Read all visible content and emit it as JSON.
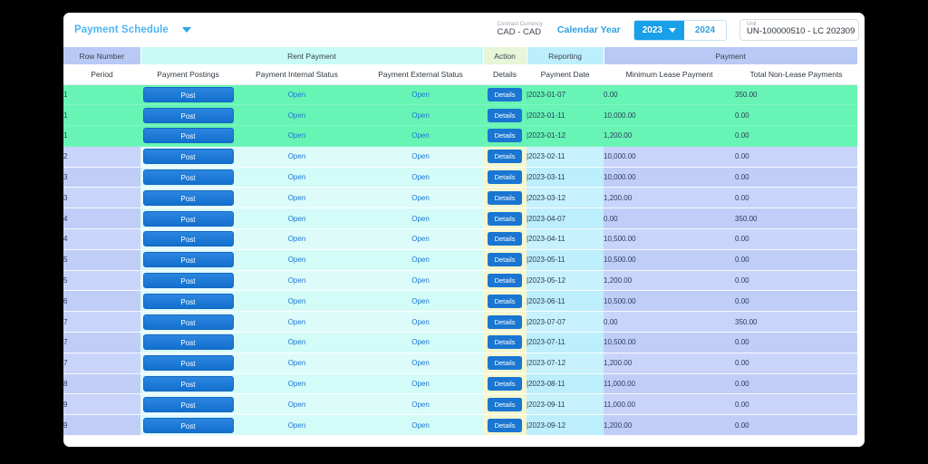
{
  "window": {
    "background": "#000000",
    "card_background": "#ffffff"
  },
  "toolbar": {
    "title": "Payment Schedule",
    "dropdown_icon": "chevron-down-icon",
    "contract_currency_label": "Contract Currency",
    "contract_currency_value": "CAD - CAD",
    "calendar_year_label": "Calendar Year",
    "year_selected": "2023",
    "year_other": "2024",
    "year_caret_icon": "chevron-down-icon",
    "unit_label": "Unit",
    "unit_value": "UN-100000510 - LC 202309"
  },
  "colors": {
    "accent_blue": "#1a76d2",
    "link_blue": "#1a76d2",
    "title_blue": "#4db4f0",
    "highlight_green": "#67f4b4",
    "group_rownum": "#b8c9f5",
    "group_rent": "#c8fbf5",
    "group_action": "#e7f5d8",
    "group_reporting": "#bdeefb",
    "group_payment": "#b8c9f5"
  },
  "table": {
    "group_headers": [
      {
        "label": "Row Number",
        "span": 1,
        "style": "g-rownum"
      },
      {
        "label": "Rent Payment",
        "span": 3,
        "style": "g-rent"
      },
      {
        "label": "Action",
        "span": 1,
        "style": "g-action"
      },
      {
        "label": "Reporting",
        "span": 1,
        "style": "g-report"
      },
      {
        "label": "Payment",
        "span": 2,
        "style": "g-payment"
      }
    ],
    "columns": [
      "Period",
      "Payment Postings",
      "Payment Internal Status",
      "Payment External Status",
      "Details",
      "Payment Date",
      "Minimum Lease Payment",
      "Total Non-Lease Payments"
    ],
    "post_button_label": "Post",
    "details_button_label": "Details",
    "rows": [
      {
        "period": "1",
        "post": "Post",
        "internal": "Open",
        "external": "Open",
        "details": "Details",
        "date": "|2023-01-07",
        "min": "0.00",
        "total": "350.00",
        "highlight": true
      },
      {
        "period": "1",
        "post": "Post",
        "internal": "Open",
        "external": "Open",
        "details": "Details",
        "date": "|2023-01-11",
        "min": "10,000.00",
        "total": "0.00",
        "highlight": true
      },
      {
        "period": "1",
        "post": "Post",
        "internal": "Open",
        "external": "Open",
        "details": "Details",
        "date": "|2023-01-12",
        "min": "1,200.00",
        "total": "0.00",
        "highlight": true
      },
      {
        "period": "2",
        "post": "Post",
        "internal": "Open",
        "external": "Open",
        "details": "Details",
        "date": "|2023-02-11",
        "min": "10,000.00",
        "total": "0.00",
        "highlight": false
      },
      {
        "period": "3",
        "post": "Post",
        "internal": "Open",
        "external": "Open",
        "details": "Details",
        "date": "|2023-03-11",
        "min": "10,000.00",
        "total": "0.00",
        "highlight": false
      },
      {
        "period": "3",
        "post": "Post",
        "internal": "Open",
        "external": "Open",
        "details": "Details",
        "date": "|2023-03-12",
        "min": "1,200.00",
        "total": "0.00",
        "highlight": false
      },
      {
        "period": "4",
        "post": "Post",
        "internal": "Open",
        "external": "Open",
        "details": "Details",
        "date": "|2023-04-07",
        "min": "0.00",
        "total": "350.00",
        "highlight": false
      },
      {
        "period": "4",
        "post": "Post",
        "internal": "Open",
        "external": "Open",
        "details": "Details",
        "date": "|2023-04-11",
        "min": "10,500.00",
        "total": "0.00",
        "highlight": false
      },
      {
        "period": "5",
        "post": "Post",
        "internal": "Open",
        "external": "Open",
        "details": "Details",
        "date": "|2023-05-11",
        "min": "10,500.00",
        "total": "0.00",
        "highlight": false
      },
      {
        "period": "5",
        "post": "Post",
        "internal": "Open",
        "external": "Open",
        "details": "Details",
        "date": "|2023-05-12",
        "min": "1,200.00",
        "total": "0.00",
        "highlight": false
      },
      {
        "period": "6",
        "post": "Post",
        "internal": "Open",
        "external": "Open",
        "details": "Details",
        "date": "|2023-06-11",
        "min": "10,500.00",
        "total": "0.00",
        "highlight": false
      },
      {
        "period": "7",
        "post": "Post",
        "internal": "Open",
        "external": "Open",
        "details": "Details",
        "date": "|2023-07-07",
        "min": "0.00",
        "total": "350.00",
        "highlight": false
      },
      {
        "period": "7",
        "post": "Post",
        "internal": "Open",
        "external": "Open",
        "details": "Details",
        "date": "|2023-07-11",
        "min": "10,500.00",
        "total": "0.00",
        "highlight": false
      },
      {
        "period": "7",
        "post": "Post",
        "internal": "Open",
        "external": "Open",
        "details": "Details",
        "date": "|2023-07-12",
        "min": "1,200.00",
        "total": "0.00",
        "highlight": false
      },
      {
        "period": "8",
        "post": "Post",
        "internal": "Open",
        "external": "Open",
        "details": "Details",
        "date": "|2023-08-11",
        "min": "11,000.00",
        "total": "0.00",
        "highlight": false
      },
      {
        "period": "9",
        "post": "Post",
        "internal": "Open",
        "external": "Open",
        "details": "Details",
        "date": "|2023-09-11",
        "min": "11,000.00",
        "total": "0.00",
        "highlight": false
      },
      {
        "period": "9",
        "post": "Post",
        "internal": "Open",
        "external": "Open",
        "details": "Details",
        "date": "|2023-09-12",
        "min": "1,200.00",
        "total": "0.00",
        "highlight": false
      }
    ]
  }
}
